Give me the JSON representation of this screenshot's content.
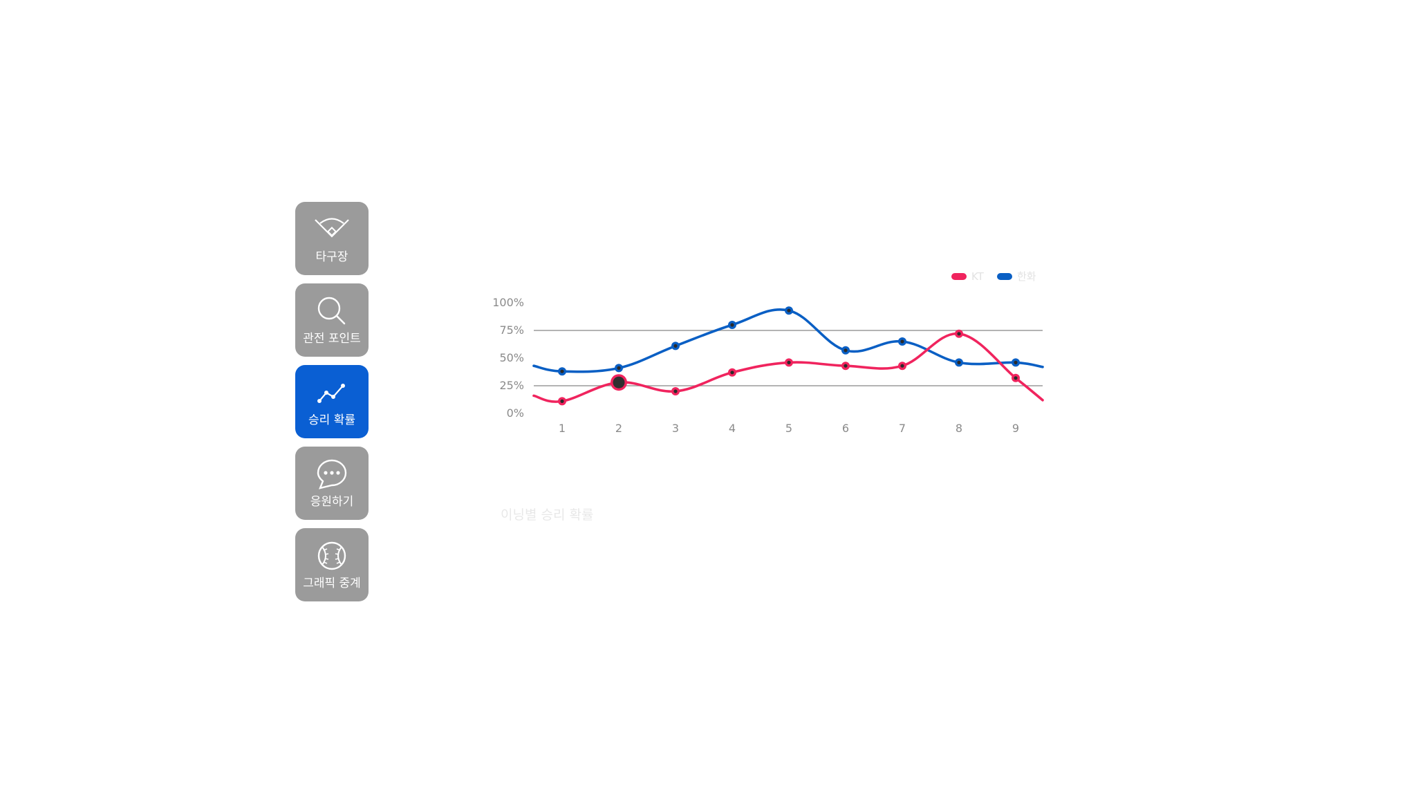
{
  "menu": {
    "items": [
      {
        "label": "타구장",
        "icon": "baseball-field-icon",
        "active": false
      },
      {
        "label": "관전 포인트",
        "icon": "search-icon",
        "active": false
      },
      {
        "label": "승리 확률",
        "icon": "line-chart-icon",
        "active": true
      },
      {
        "label": "응원하기",
        "icon": "chat-bubble-icon",
        "active": false
      },
      {
        "label": "그래픽 중계",
        "icon": "baseball-icon",
        "active": false
      }
    ],
    "colors": {
      "inactive": "#9b9b9b",
      "active": "#0a5fd3"
    }
  },
  "caption": "이닝별 승리 확률",
  "chart_data": {
    "type": "line",
    "x": [
      1,
      2,
      3,
      4,
      5,
      6,
      7,
      8,
      9
    ],
    "categories": [
      "1",
      "2",
      "3",
      "4",
      "5",
      "6",
      "7",
      "8",
      "9"
    ],
    "y_ticks": [
      "100%",
      "75%",
      "50%",
      "25%",
      "0%"
    ],
    "y_tick_values": [
      100,
      75,
      50,
      25,
      0
    ],
    "ylim": [
      0,
      100
    ],
    "gridlines": [
      75,
      25
    ],
    "legend_position": "top-right",
    "highlight": {
      "series": "KT",
      "x": 2
    },
    "series": [
      {
        "name": "KT",
        "color": "#f0245e",
        "values": [
          11,
          28,
          20,
          37,
          46,
          43,
          43,
          72,
          32
        ],
        "start": 16,
        "end": 12
      },
      {
        "name": "한화",
        "color": "#0a5fc4",
        "values": [
          38,
          41,
          61,
          80,
          93,
          57,
          65,
          46,
          46
        ],
        "start": 43,
        "end": 42
      }
    ]
  }
}
